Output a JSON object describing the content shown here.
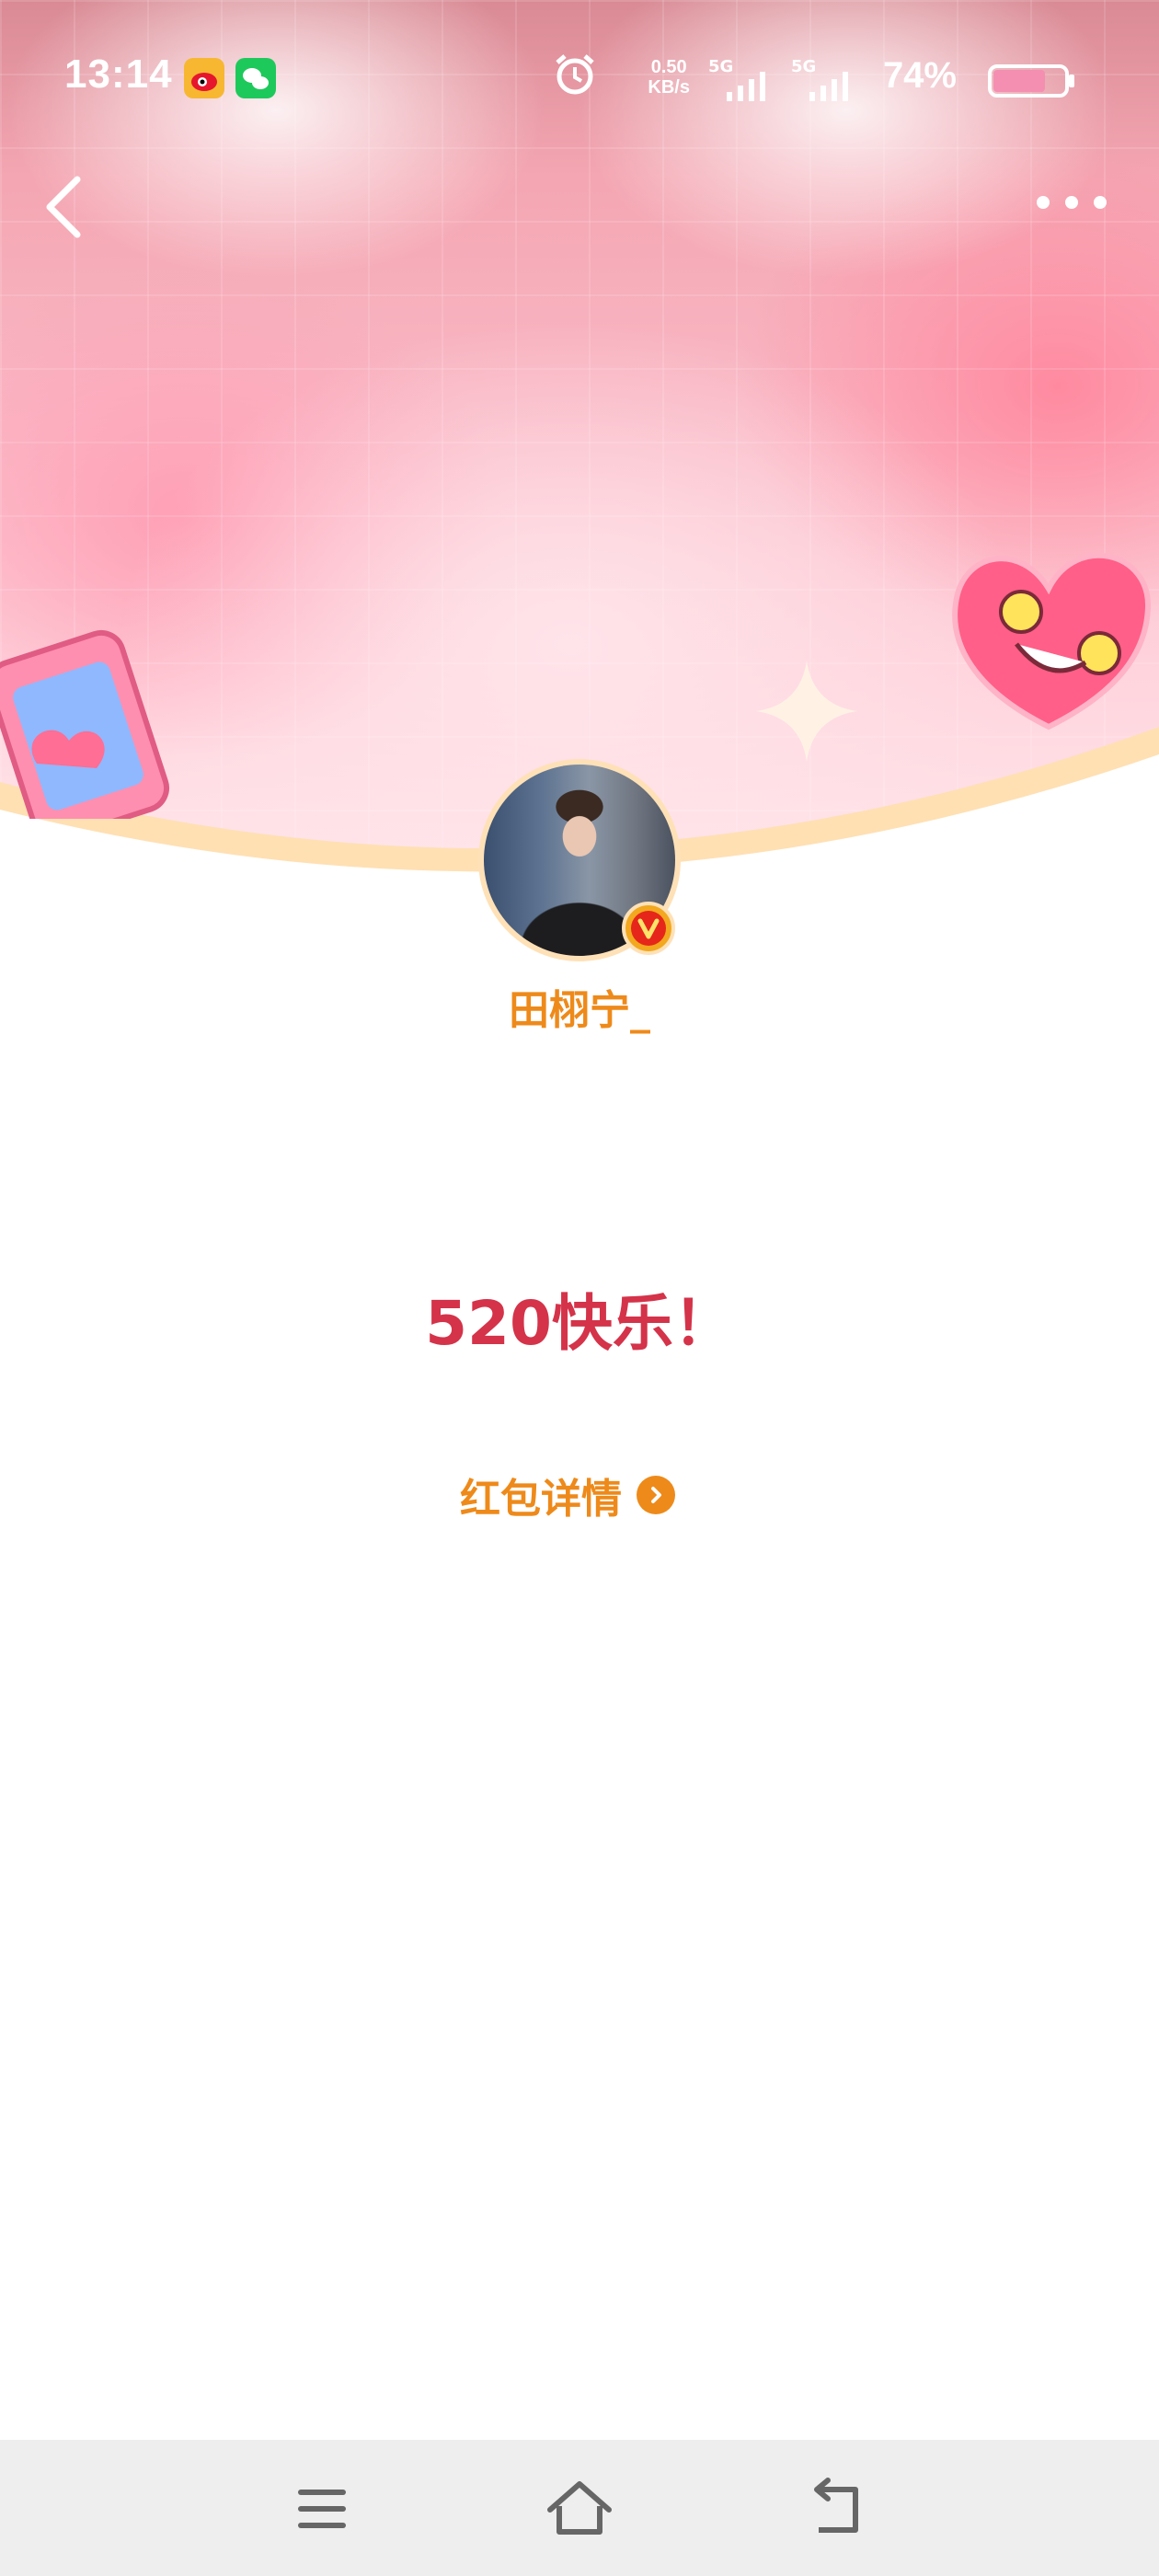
{
  "status_bar": {
    "time": "13:14",
    "net_speed_value": "0.50",
    "net_speed_unit": "KB/s",
    "sim1_label": "5G",
    "sim2_label": "5G",
    "battery_percent": "74%",
    "battery_level": 0.74,
    "notification_icons": [
      "weibo-icon",
      "wechat-icon"
    ]
  },
  "header": {
    "back_icon": "chevron-left-icon",
    "more_icon": "more-dots-icon"
  },
  "sender": {
    "name": "田栩宁_",
    "verified_badge": "V"
  },
  "message": {
    "text": "520快乐！"
  },
  "details": {
    "label": "红包详情"
  },
  "nav_bar": {
    "icons": [
      "menu-icon",
      "home-icon",
      "back-icon"
    ]
  },
  "colors": {
    "accent_orange": "#ee8a1a",
    "message_red": "#d4334a",
    "badge_orange": "#f2a81f"
  }
}
